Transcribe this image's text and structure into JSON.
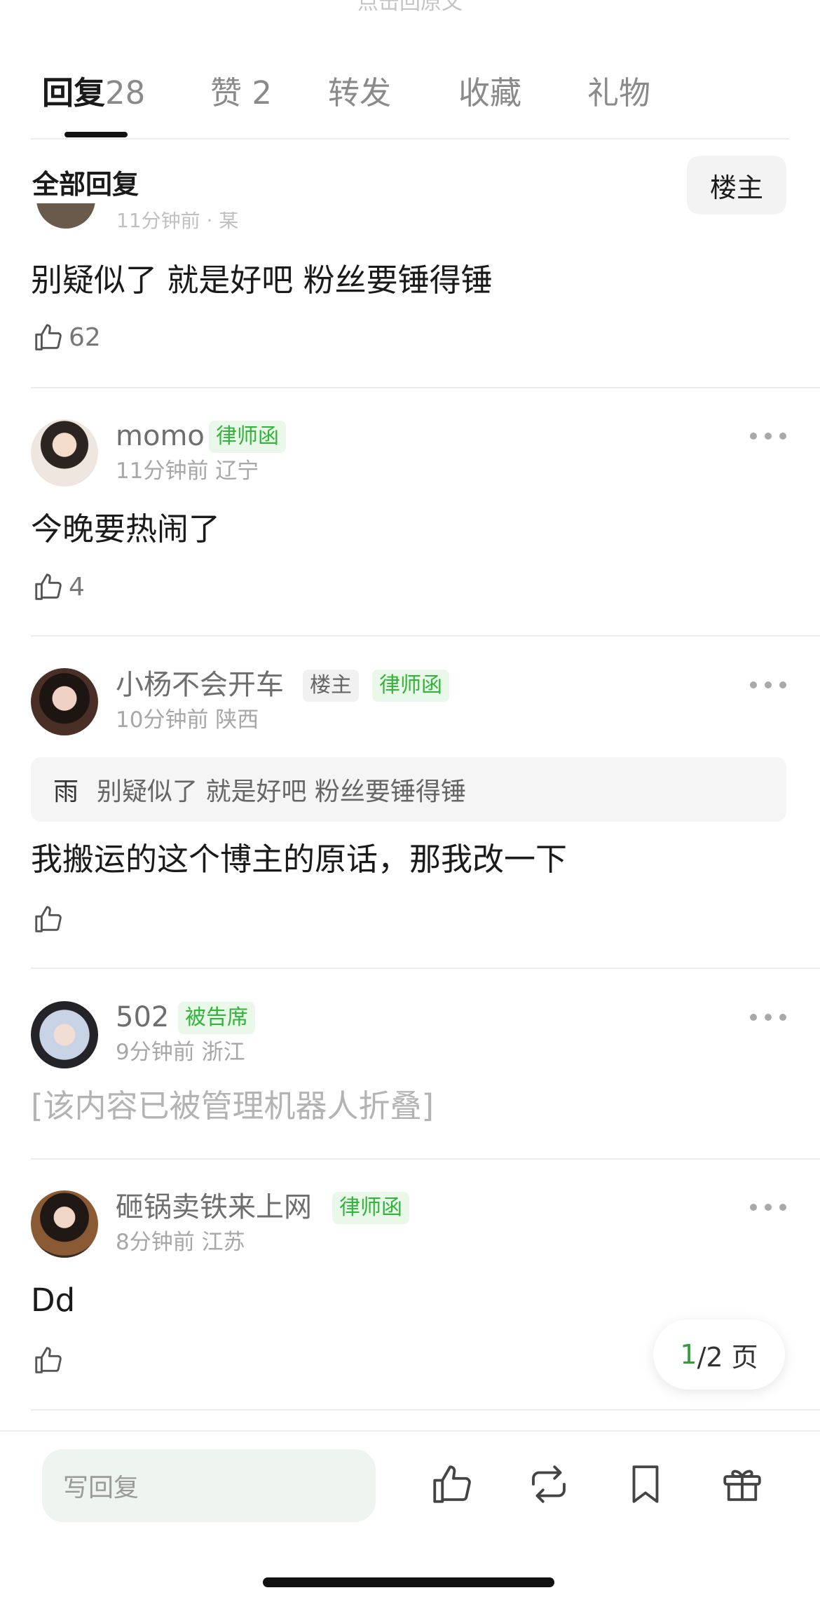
{
  "top_hint": "点击回原文",
  "tabs": [
    {
      "label": "回复",
      "count": "28"
    },
    {
      "label": "赞",
      "count": "2"
    },
    {
      "label": "转发",
      "count": ""
    },
    {
      "label": "收藏",
      "count": ""
    },
    {
      "label": "礼物",
      "count": ""
    }
  ],
  "filter": {
    "title": "全部回复",
    "owner_button": "楼主"
  },
  "partial_comment": {
    "meta": "11分钟前 · 某",
    "text": "别疑似了 就是好吧 粉丝要锤得锤",
    "likes": "62"
  },
  "comments": [
    {
      "username": "momo",
      "badges": [
        "律师函"
      ],
      "meta": "11分钟前 辽宁",
      "text": "今晚要热闹了",
      "likes": "4"
    },
    {
      "username": "小杨不会开车",
      "badges": [
        "楼主",
        "律师函"
      ],
      "meta": "10分钟前 陕西",
      "quote_name": "雨",
      "quote_text": "别疑似了 就是好吧 粉丝要锤得锤",
      "text": "我搬运的这个博主的原话，那我改一下",
      "likes": ""
    },
    {
      "username": "502",
      "badges": [
        "被告席"
      ],
      "meta": "9分钟前 浙江",
      "text": "[该内容已被管理机器人折叠]",
      "likes": ""
    },
    {
      "username": "砸锅卖铁来上网",
      "badges": [
        "律师函"
      ],
      "meta": "8分钟前 江苏",
      "text": "Dd",
      "likes": ""
    }
  ],
  "pager": {
    "current": "1",
    "total": "/2 页"
  },
  "bottom_bar": {
    "reply_placeholder": "写回复",
    "icons": [
      "thumbs-up-icon",
      "repost-icon",
      "bookmark-icon",
      "gift-icon"
    ]
  },
  "colors": {
    "accent_green": "#32b43a",
    "badge_bg": "#eaf8ea",
    "input_bg": "#eef4ef"
  }
}
